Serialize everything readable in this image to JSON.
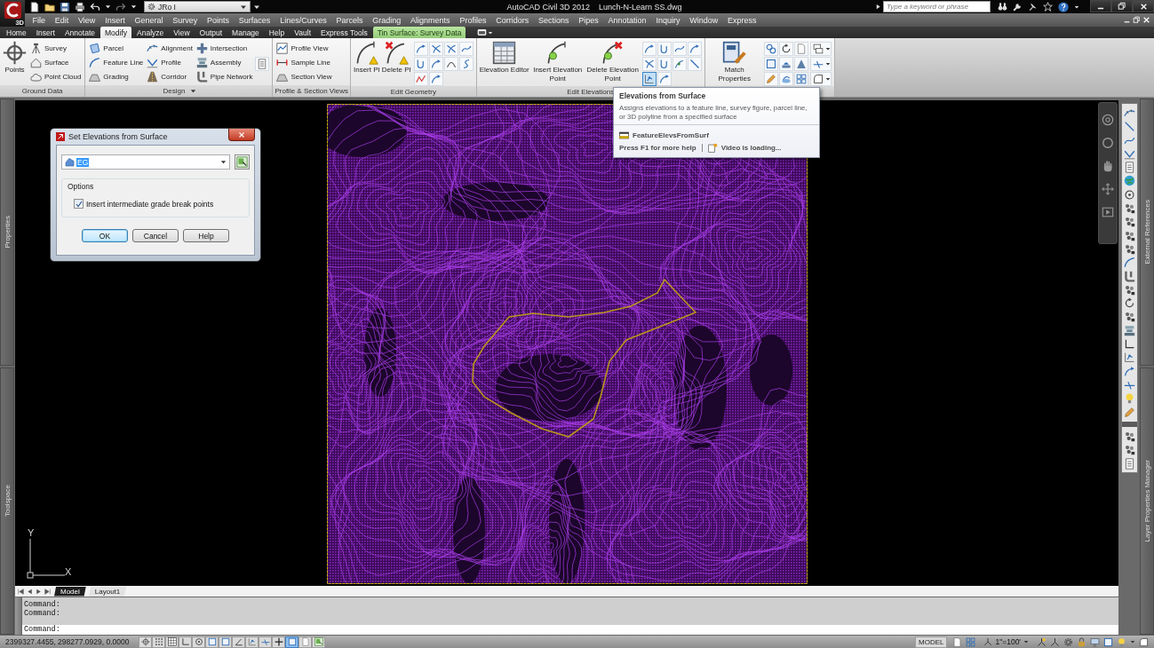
{
  "title_bar": {
    "app_badge": "3D",
    "workspace": "JRo I",
    "app_name": "AutoCAD Civil 3D 2012",
    "file_name": "Lunch-N-Learn SS.dwg",
    "search": {
      "placeholder": "Type a keyword or phrase"
    }
  },
  "menu_bar": [
    "File",
    "Edit",
    "View",
    "Insert",
    "General",
    "Survey",
    "Points",
    "Surfaces",
    "Lines/Curves",
    "Parcels",
    "Grading",
    "Alignments",
    "Profiles",
    "Corridors",
    "Sections",
    "Pipes",
    "Annotation",
    "Inquiry",
    "Window",
    "Express"
  ],
  "ribbon_tabs": [
    {
      "label": "Home",
      "selected": false,
      "kind": "standard"
    },
    {
      "label": "Insert",
      "selected": false,
      "kind": "standard"
    },
    {
      "label": "Annotate",
      "selected": false,
      "kind": "standard"
    },
    {
      "label": "Modify",
      "selected": true,
      "kind": "standard"
    },
    {
      "label": "Analyze",
      "selected": false,
      "kind": "standard"
    },
    {
      "label": "View",
      "selected": false,
      "kind": "standard"
    },
    {
      "label": "Output",
      "selected": false,
      "kind": "standard"
    },
    {
      "label": "Manage",
      "selected": false,
      "kind": "standard"
    },
    {
      "label": "Help",
      "selected": false,
      "kind": "standard"
    },
    {
      "label": "Vault",
      "selected": false,
      "kind": "standard"
    },
    {
      "label": "Express Tools",
      "selected": false,
      "kind": "standard"
    },
    {
      "label": "Tin Surface: Survey Data",
      "selected": false,
      "kind": "contextual"
    }
  ],
  "ribbon_panels": [
    {
      "title": "Ground Data",
      "menu": false,
      "groups": [
        {
          "kind": "large",
          "items": [
            {
              "label": "Points"
            }
          ]
        },
        {
          "kind": "list",
          "items": [
            {
              "label": "Survey"
            },
            {
              "label": "Surface"
            },
            {
              "label": "Point Cloud"
            }
          ]
        }
      ]
    },
    {
      "title": "Design",
      "menu": true,
      "groups": [
        {
          "kind": "list",
          "items": [
            {
              "label": "Parcel"
            },
            {
              "label": "Feature Line"
            },
            {
              "label": "Grading"
            }
          ]
        },
        {
          "kind": "list",
          "items": [
            {
              "label": "Alignment"
            },
            {
              "label": "Profile"
            },
            {
              "label": "Corridor"
            }
          ]
        },
        {
          "kind": "list",
          "items": [
            {
              "label": "Intersection"
            },
            {
              "label": "Assembly"
            },
            {
              "label": "Pipe Network"
            }
          ]
        },
        {
          "kind": "grid",
          "items": [
            {
              "selected": false
            }
          ]
        }
      ]
    },
    {
      "title": "Profile & Section Views",
      "menu": false,
      "groups": [
        {
          "kind": "list",
          "items": [
            {
              "label": "Profile View"
            },
            {
              "label": "Sample Line"
            },
            {
              "label": "Section View"
            }
          ]
        }
      ]
    },
    {
      "title": "Edit Geometry",
      "menu": false,
      "groups": [
        {
          "kind": "large",
          "items": [
            {
              "label": "Insert PI"
            },
            {
              "label": "Delete PI"
            }
          ]
        },
        {
          "kind": "grid",
          "items": [
            {
              "selected": false
            },
            {
              "selected": false
            },
            {
              "selected": false
            },
            {
              "selected": false
            },
            {
              "selected": false
            },
            {
              "selected": false
            },
            {
              "selected": false
            },
            {
              "selected": false
            },
            {
              "selected": false
            },
            {
              "selected": false
            }
          ]
        }
      ]
    },
    {
      "title": "Edit Elevations",
      "menu": false,
      "groups": [
        {
          "kind": "large",
          "items": [
            {
              "label": "Elevation Editor"
            },
            {
              "label": "Insert Elevation Point"
            },
            {
              "label": "Delete Elevation Point"
            }
          ]
        },
        {
          "kind": "grid",
          "items": [
            {
              "selected": false
            },
            {
              "selected": false
            },
            {
              "selected": false
            },
            {
              "selected": false
            },
            {
              "selected": false
            },
            {
              "selected": false
            },
            {
              "selected": false
            },
            {
              "selected": false
            },
            {
              "selected": true
            },
            {
              "selected": false
            }
          ]
        }
      ]
    },
    {
      "menu": false,
      "groups": [
        {
          "kind": "large",
          "items": [
            {
              "label": "Match Properties"
            }
          ]
        },
        {
          "kind": "grid",
          "items": [
            {
              "selected": false
            },
            {
              "selected": false
            },
            {
              "selected": false
            },
            {
              "selected": false
            },
            {
              "selected": false
            },
            {
              "selected": false
            },
            {
              "selected": false
            },
            {
              "selected": false
            },
            {
              "selected": false
            }
          ]
        },
        {
          "kind": "split",
          "items": [
            {
              "selected": false
            },
            {
              "selected": false
            },
            {
              "selected": false
            }
          ]
        }
      ]
    }
  ],
  "tooltip": {
    "title": "Elevations from Surface",
    "description": "Assigns elevations to a feature line, survey figure, parcel line, or 3D polyline from a specified surface",
    "command": "FeatureElevsFromSurf",
    "help": "Press F1 for more help",
    "video": "Video is loading..."
  },
  "palettes": {
    "left": [
      "Properties",
      "Toolspace"
    ],
    "right": [
      "External References",
      "Layer Properties Manager"
    ]
  },
  "dialog": {
    "title": "Set Elevations from Surface",
    "surface": {
      "value": "EG"
    },
    "options": {
      "title": "Options",
      "items": [
        {
          "label": "Insert intermediate grade break points",
          "checked": true
        }
      ]
    },
    "buttons": [
      {
        "label": "OK",
        "default": true
      },
      {
        "label": "Cancel",
        "default": false
      },
      {
        "label": "Help",
        "default": false
      }
    ]
  },
  "ucs": {
    "y_label": "Y",
    "x_label": "X"
  },
  "layout_tabs": [
    {
      "label": "Model",
      "selected": true
    },
    {
      "label": "Layout1",
      "selected": false
    }
  ],
  "command_line": {
    "history": [
      "Command:",
      "Command:"
    ],
    "prompt": "Command:"
  },
  "status_bar": {
    "coordinates": "2399327.4455, 298277.0929, 0.0000",
    "toggles": [
      {
        "on": false
      },
      {
        "on": false
      },
      {
        "on": false
      },
      {
        "on": false
      },
      {
        "on": false
      },
      {
        "on": false
      },
      {
        "on": false
      },
      {
        "on": false
      },
      {
        "on": false
      },
      {
        "on": false
      },
      {
        "on": false
      },
      {
        "on": true
      },
      {
        "on": false
      },
      {
        "on": false
      }
    ],
    "space": "MODEL",
    "annotation_scale": "1\"=100'"
  }
}
